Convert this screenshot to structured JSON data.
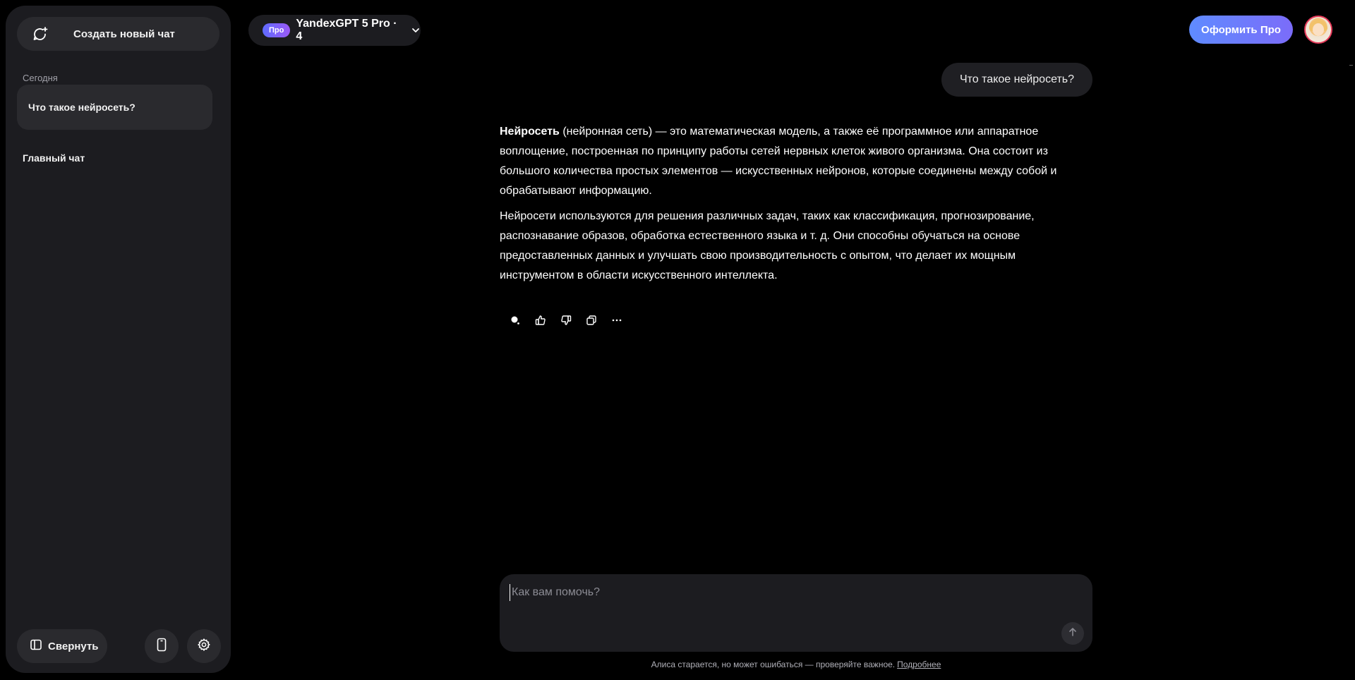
{
  "sidebar": {
    "new_chat_label": "Создать новый чат",
    "section_today": "Сегодня",
    "active_chat": "Что такое нейросеть?",
    "chats": [
      "Главный чат"
    ],
    "collapse_label": "Свернуть"
  },
  "header": {
    "pro_badge": "Про",
    "model_name": "YandexGPT 5 Pro · 4",
    "get_pro_label": "Оформить Про"
  },
  "conversation": {
    "user_message": "Что такое нейросеть?",
    "answer": {
      "term": "Нейросеть",
      "p1_rest": " (нейронная сеть) — это математическая модель, а также её программное или аппаратное воплощение, построенная по принципу работы сетей нервных клеток живого организма. Она состоит из большого количества простых элементов — искусственных нейронов, которые соединены между собой и обрабатывают информацию.",
      "p2": "Нейросети используются для решения различных задач, таких как классификация, прогнозирование, распознавание образов, обработка естественного языка и т. д. Они способны обучаться на основе предоставленных данных и улучшать свою производительность с опытом, что делает их мощным инструментом в области искусственного интеллекта."
    },
    "actions": [
      "alice-voice-icon",
      "thumbs-up-icon",
      "thumbs-down-icon",
      "copy-icon",
      "more-icon"
    ]
  },
  "composer": {
    "placeholder": "Как вам помочь?",
    "value": ""
  },
  "footer": {
    "disclaimer": "Алиса старается, но может ошибаться — проверяйте важное.",
    "more_link": "Подробнее"
  },
  "colors": {
    "background": "#000000",
    "sidebar": "#1c1c20",
    "accent_gradient_start": "#5f8bff",
    "accent_gradient_end": "#7b6cf9",
    "pro_badge_start": "#5f6bff",
    "pro_badge_end": "#9b59f5"
  }
}
